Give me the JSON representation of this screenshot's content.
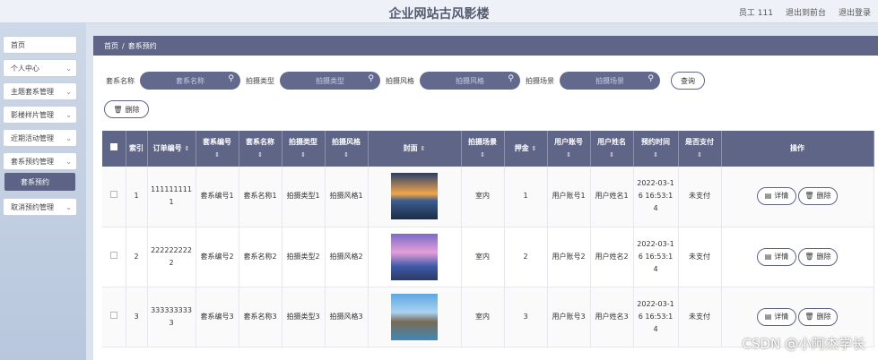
{
  "header": {
    "title": "企业网站古风影楼",
    "user": "员工 111",
    "to_front": "退出到前台",
    "logout": "退出登录"
  },
  "sidebar": {
    "items": [
      {
        "label": "首页",
        "chevron": false
      },
      {
        "label": "个人中心",
        "chevron": true
      },
      {
        "label": "主题套系管理",
        "chevron": true
      },
      {
        "label": "影楼样片管理",
        "chevron": true
      },
      {
        "label": "近期活动管理",
        "chevron": true
      },
      {
        "label": "套系预约管理",
        "chevron": true
      },
      {
        "label": "取消预约管理",
        "chevron": true
      }
    ],
    "submenu": "套系预约"
  },
  "breadcrumb": {
    "home": "首页",
    "sep": "/",
    "current": "套系预约"
  },
  "filters": [
    {
      "label": "套系名称",
      "placeholder": "套系名称"
    },
    {
      "label": "拍摄类型",
      "placeholder": "拍摄类型"
    },
    {
      "label": "拍摄风格",
      "placeholder": "拍摄风格"
    },
    {
      "label": "拍摄场景",
      "placeholder": "拍摄场景"
    }
  ],
  "query_label": "查询",
  "delete_label": "删除",
  "table": {
    "headers": [
      "索引",
      "订单编号",
      "套系编号",
      "套系名称",
      "拍摄类型",
      "拍摄风格",
      "封面",
      "拍摄场景",
      "押金",
      "用户账号",
      "用户姓名",
      "预约时间",
      "是否支付",
      "操作"
    ],
    "rows": [
      {
        "index": "1",
        "order": "1111111111",
        "suite_no": "套系编号1",
        "suite_name": "套系名称1",
        "type": "拍摄类型1",
        "style": "拍摄风格1",
        "scene": "室内",
        "deposit": "1",
        "account": "用户账号1",
        "name": "用户姓名1",
        "time": "2022-03-16 16:53:14",
        "paid": "未支付"
      },
      {
        "index": "2",
        "order": "2222222222",
        "suite_no": "套系编号2",
        "suite_name": "套系名称2",
        "type": "拍摄类型2",
        "style": "拍摄风格2",
        "scene": "室内",
        "deposit": "2",
        "account": "用户账号2",
        "name": "用户姓名2",
        "time": "2022-03-16 16:53:14",
        "paid": "未支付"
      },
      {
        "index": "3",
        "order": "3333333333",
        "suite_no": "套系编号3",
        "suite_name": "套系名称3",
        "type": "拍摄类型3",
        "style": "拍摄风格3",
        "scene": "室内",
        "deposit": "3",
        "account": "用户账号3",
        "name": "用户姓名3",
        "time": "2022-03-16 16:53:14",
        "paid": "未支付"
      }
    ],
    "detail_label": "详情",
    "delete_label": "删除"
  },
  "watermark": "CSDN @小阿杰学长"
}
